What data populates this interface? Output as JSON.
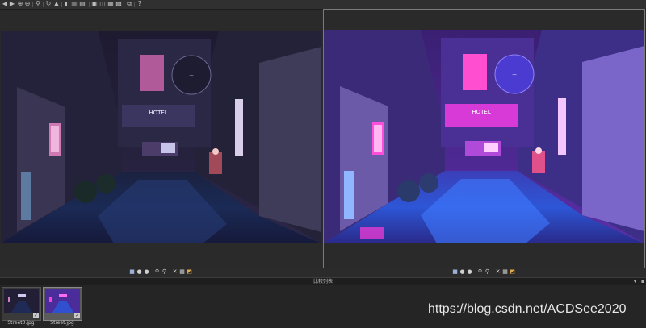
{
  "compare_bar": {
    "label": "比较列表"
  },
  "filmstrip": {
    "items": [
      {
        "filename": "Street0.jpg",
        "selected": false,
        "checked": true
      },
      {
        "filename": "Street.jpg",
        "selected": true,
        "checked": true
      }
    ]
  },
  "watermark": {
    "text": "https://blog.csdn.net/ACDSee2020"
  },
  "colors": {
    "background": "#2b2b2b",
    "accent_border": "#7a7a7a"
  },
  "icons": {
    "top_toolbar": [
      "prev-icon",
      "next-icon",
      "zoom-in-icon",
      "zoom-out-icon",
      "zoom-menu-icon",
      "rotate-icon",
      "warning-icon",
      "adjust-icon",
      "histogram-icon",
      "info-icon",
      "single-view-icon",
      "dual-view-icon",
      "grid-view-icon",
      "sync-icon",
      "help-icon"
    ],
    "pane_toolbar": [
      "save-icon",
      "prev-icon",
      "next-icon",
      "zoom-in-icon",
      "zoom-out-icon",
      "close-icon",
      "grid-icon",
      "edit-icon"
    ]
  }
}
